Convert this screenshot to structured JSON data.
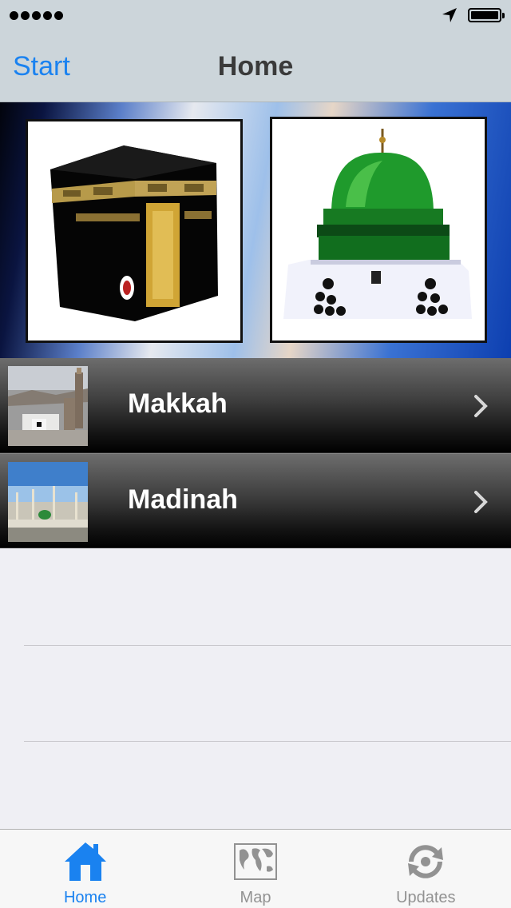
{
  "status_bar": {
    "signal_icon": "signal-dots-icon",
    "location_icon": "location-arrow-icon",
    "battery_icon": "battery-icon"
  },
  "nav": {
    "back_label": "Start",
    "title": "Home"
  },
  "banner": {
    "left_image": "kaaba-image",
    "right_image": "green-dome-image"
  },
  "list": {
    "items": [
      {
        "label": "Makkah",
        "thumbnail": "makkah-thumbnail"
      },
      {
        "label": "Madinah",
        "thumbnail": "madinah-thumbnail"
      }
    ]
  },
  "tab_bar": {
    "tabs": [
      {
        "label": "Home",
        "icon": "home-icon",
        "active": true
      },
      {
        "label": "Map",
        "icon": "map-icon",
        "active": false
      },
      {
        "label": "Updates",
        "icon": "updates-icon",
        "active": false
      }
    ]
  },
  "colors": {
    "accent": "#1a82f0",
    "nav_background": "#ccd5da",
    "inactive_tab": "#929292"
  }
}
